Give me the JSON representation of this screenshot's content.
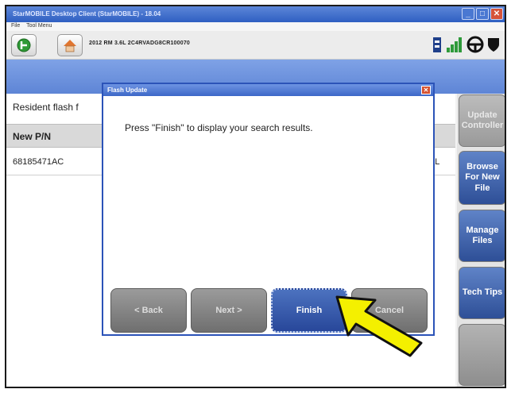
{
  "window": {
    "title": "StarMOBILE Desktop Client (StarMOBILE) - 18.04",
    "min_label": "_",
    "max_label": "□",
    "close_label": "✕"
  },
  "menu": {
    "items": [
      "File",
      "Tool Menu"
    ]
  },
  "toolbar": {
    "vehicle_info": "2012 RM 3.6L 2C4RVADG8CR100070",
    "icons": [
      "go-icon",
      "home-icon",
      "battery-icon",
      "signal-icon",
      "steering-wheel-icon",
      "shield-icon"
    ]
  },
  "main": {
    "resident_label": "Resident flash f",
    "column_header": "New P/N",
    "row_pn": "68185471AC",
    "row_right": "DAL"
  },
  "sidebar": {
    "update_controller": "Update Controller",
    "browse_new_file": "Browse For New File",
    "manage_files": "Manage Files",
    "tech_tips": "Tech Tips"
  },
  "dialog": {
    "title": "Flash Update",
    "close_label": "✕",
    "message": "Press \"Finish\" to display your search results.",
    "back_label": "< Back",
    "next_label": "Next >",
    "finish_label": "Finish",
    "cancel_label": "Cancel"
  },
  "colors": {
    "accent_blue": "#2e4f97",
    "highlight_arrow": "#f4f000",
    "disabled_gray": "#8e8e8e"
  }
}
